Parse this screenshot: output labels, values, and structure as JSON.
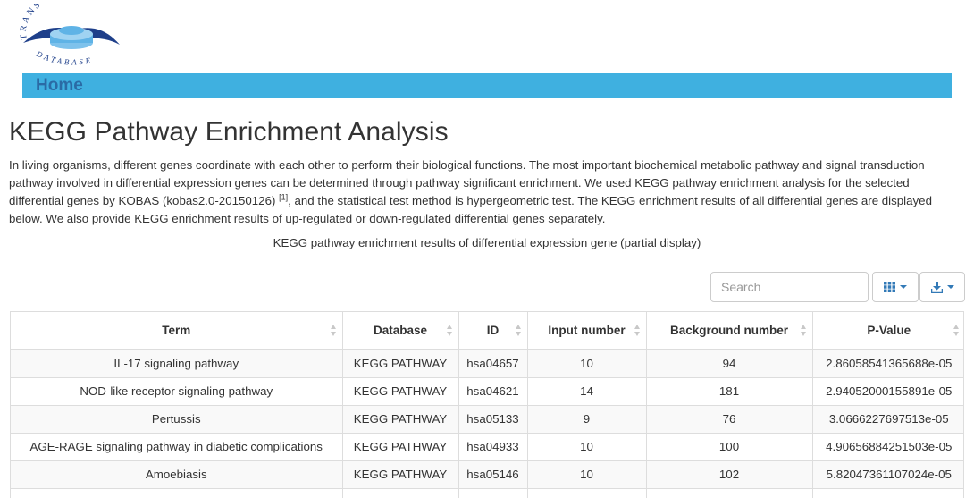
{
  "logo": {
    "top_text": "TRANSLATOME",
    "bottom_text": "DATABASE"
  },
  "nav": {
    "home_label": "Home"
  },
  "page": {
    "title": "KEGG Pathway Enrichment Analysis",
    "intro_part1": "In living organisms, different genes coordinate with each other to perform their biological functions. The most important biochemical metabolic pathway and signal transduction pathway involved in differential expression genes can be determined through pathway significant enrichment. We used KEGG pathway enrichment analysis for the selected differential genes by KOBAS (kobas2.0-20150126) ",
    "intro_ref": "[1]",
    "intro_part2": ", and the statistical test method is hypergeometric test. The KEGG enrichment results of all differential genes are displayed below. We also provide KEGG enrichment results of up-regulated or down-regulated differential genes separately.",
    "caption": "KEGG pathway enrichment results of differential expression gene (partial display)"
  },
  "toolbar": {
    "search_placeholder": "Search",
    "columns_icon": "grid-icon",
    "export_icon": "download-icon",
    "accent_color": "#337ab7"
  },
  "table": {
    "headers": [
      "Term",
      "Database",
      "ID",
      "Input number",
      "Background number",
      "P-Value"
    ],
    "rows": [
      [
        "IL-17 signaling pathway",
        "KEGG PATHWAY",
        "hsa04657",
        "10",
        "94",
        "2.86058541365688e-05"
      ],
      [
        "NOD-like receptor signaling pathway",
        "KEGG PATHWAY",
        "hsa04621",
        "14",
        "181",
        "2.94052000155891e-05"
      ],
      [
        "Pertussis",
        "KEGG PATHWAY",
        "hsa05133",
        "9",
        "76",
        "3.0666227697513e-05"
      ],
      [
        "AGE-RAGE signaling pathway in diabetic complications",
        "KEGG PATHWAY",
        "hsa04933",
        "10",
        "100",
        "4.90656884251503e-05"
      ],
      [
        "Amoebiasis",
        "KEGG PATHWAY",
        "hsa05146",
        "10",
        "102",
        "5.82047361107024e-05"
      ],
      [
        "",
        "",
        "",
        "",
        "",
        ""
      ]
    ]
  },
  "colors": {
    "navbar": "#3fb0e0",
    "home_link": "#2a6ba5",
    "logo_dark": "#1e3f8a",
    "logo_light": "#5fb3e6"
  }
}
